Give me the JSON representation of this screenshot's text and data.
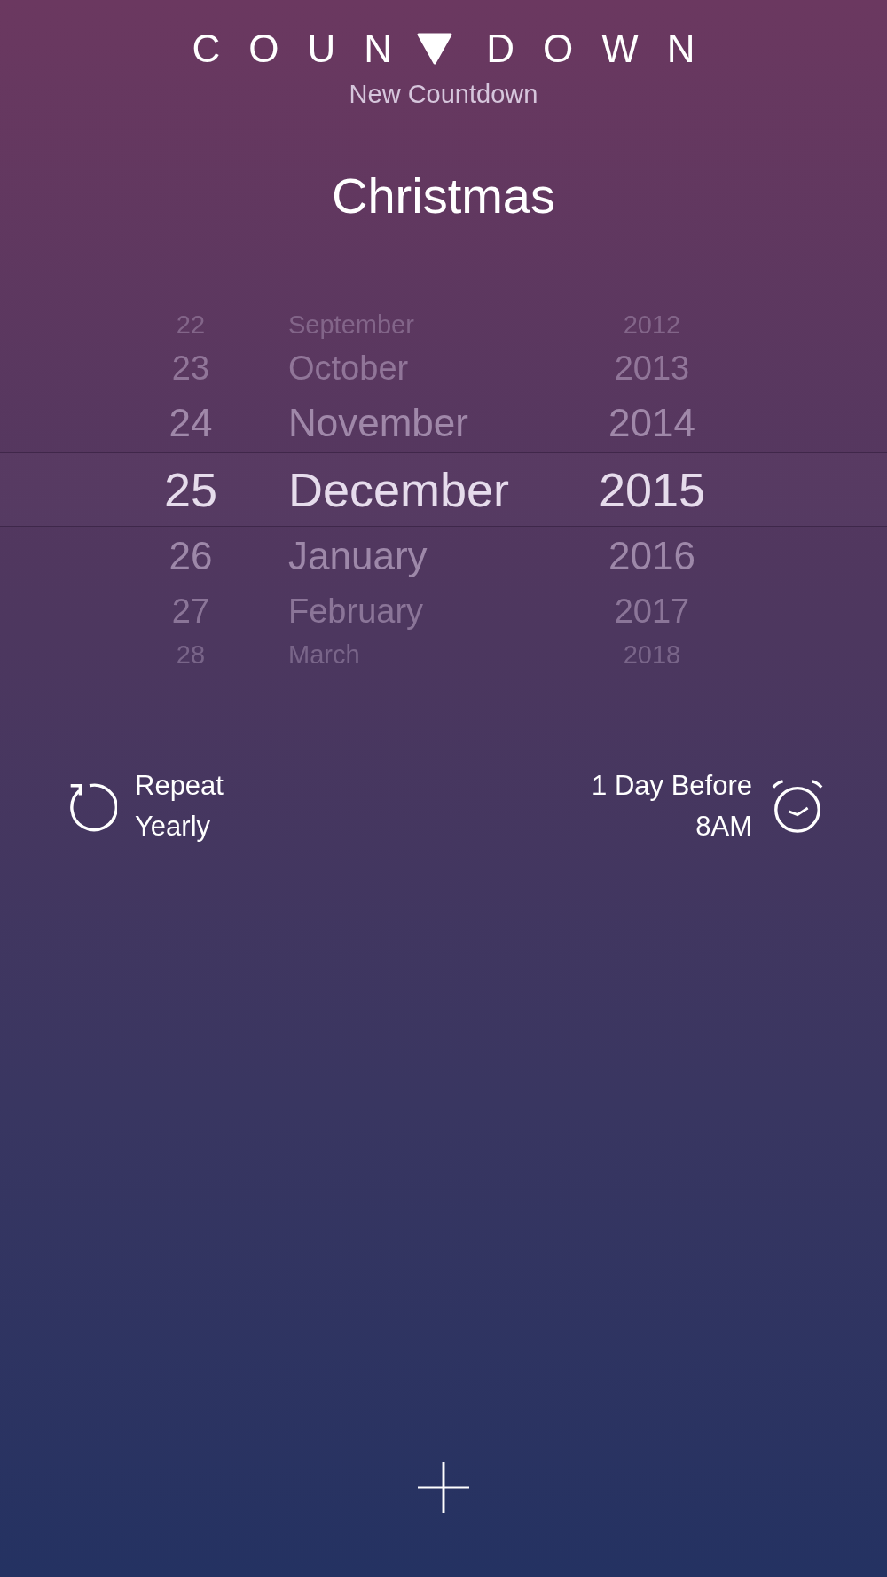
{
  "header": {
    "logo_left": "COUN",
    "logo_right": "DOWN",
    "subtitle": "New Countdown"
  },
  "event_name": "Christmas",
  "date_picker": {
    "rows": [
      {
        "day": "22",
        "month": "September",
        "year": "2012",
        "selected": false
      },
      {
        "day": "23",
        "month": "October",
        "year": "2013",
        "selected": false
      },
      {
        "day": "24",
        "month": "November",
        "year": "2014",
        "selected": false
      },
      {
        "day": "25",
        "month": "December",
        "year": "2015",
        "selected": true
      },
      {
        "day": "26",
        "month": "January",
        "year": "2016",
        "selected": false
      },
      {
        "day": "27",
        "month": "February",
        "year": "2017",
        "selected": false
      },
      {
        "day": "28",
        "month": "March",
        "year": "2018",
        "selected": false
      }
    ]
  },
  "repeat": {
    "label": "Repeat",
    "value": "Yearly"
  },
  "reminder": {
    "label": "1 Day Before",
    "value": "8AM"
  }
}
